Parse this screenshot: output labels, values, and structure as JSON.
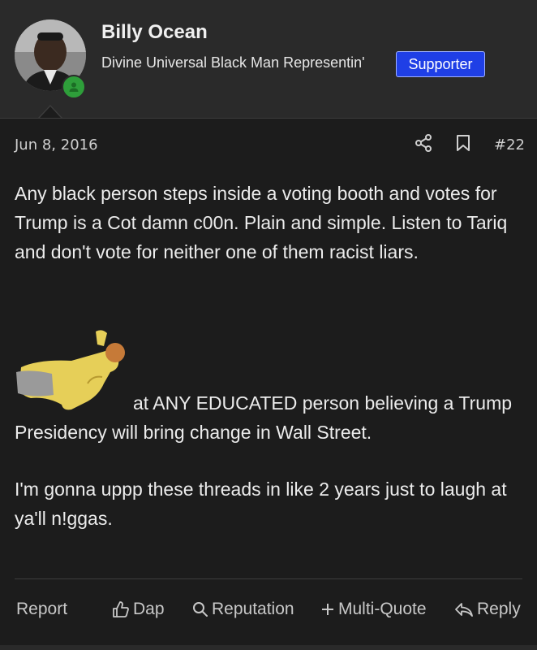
{
  "user": {
    "name": "Billy Ocean",
    "title": "Divine Universal Black Man Representin'",
    "badge": "Supporter",
    "badge_color": "#1f3fe6",
    "status": "online"
  },
  "post": {
    "date": "Jun 8, 2016",
    "number": "#22",
    "paragraph1": "Any black person steps inside a voting booth and votes for Trump is a Cot damn c00n. Plain and simple. Listen to Tariq and don't vote for neither one of them racist liars.",
    "paragraph2": "at ANY EDUCATED person believing a Trump Presidency will bring change in Wall Street.",
    "paragraph3": "I'm gonna uppp these threads in like 2 years just to laugh at ya'll n!ggas."
  },
  "actions": {
    "report": "Report",
    "dap": "Dap",
    "reputation": "Reputation",
    "multiquote": "Multi-Quote",
    "reply": "Reply"
  },
  "icons": {
    "share": "share-icon",
    "bookmark": "bookmark-icon",
    "thumbs_up": "thumbs-up-icon",
    "search": "search-icon",
    "plus": "plus-icon",
    "reply": "reply-icon"
  }
}
